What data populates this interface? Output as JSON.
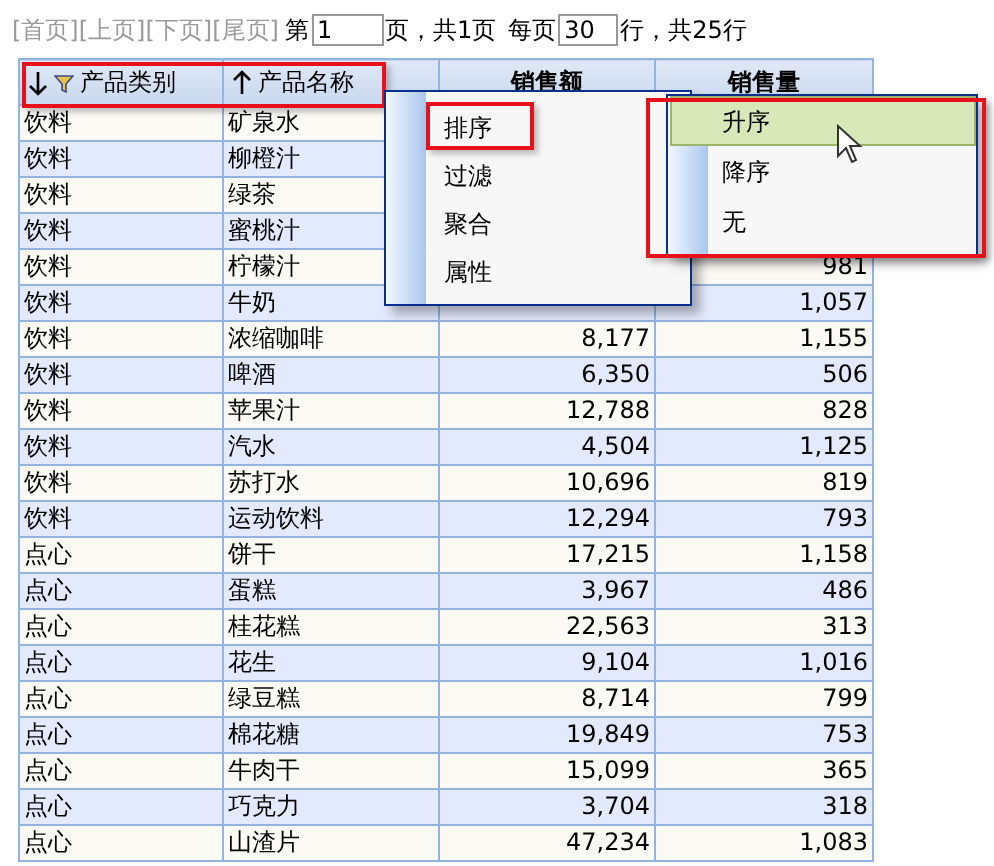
{
  "pager": {
    "links": [
      {
        "label": "[首页]",
        "disabled": true
      },
      {
        "label": "[上页]",
        "disabled": true
      },
      {
        "label": "[下页]",
        "disabled": true
      },
      {
        "label": "[尾页]",
        "disabled": true
      }
    ],
    "page_prefix": "第",
    "page_value": "1",
    "page_suffix": "页，共1页",
    "per_page_prefix": "每页",
    "per_page_value": "30",
    "per_page_suffix": "行，共25行"
  },
  "table": {
    "columns": [
      {
        "label": "产品类别",
        "kind": "text",
        "sorted_descending": true,
        "sorted_ascending": false,
        "filtered": true
      },
      {
        "label": "产品名称",
        "kind": "text",
        "sorted_descending": false,
        "sorted_ascending": true,
        "filtered": false
      },
      {
        "label": "销售额",
        "kind": "number",
        "sorted_descending": false,
        "sorted_ascending": false,
        "filtered": false
      },
      {
        "label": "销售量",
        "kind": "number",
        "sorted_descending": false,
        "sorted_ascending": false,
        "filtered": false
      }
    ],
    "rows": [
      {
        "category": "饮料",
        "name": "矿泉水"
      },
      {
        "category": "饮料",
        "name": "柳橙汁"
      },
      {
        "category": "饮料",
        "name": "绿茶"
      },
      {
        "category": "饮料",
        "name": "蜜桃汁"
      },
      {
        "category": "饮料",
        "name": "柠檬汁",
        "quantity": "981"
      },
      {
        "category": "饮料",
        "name": "牛奶",
        "quantity": "1,057"
      },
      {
        "category": "饮料",
        "name": "浓缩咖啡",
        "sales": "8,177",
        "quantity": "1,155"
      },
      {
        "category": "饮料",
        "name": "啤酒",
        "sales": "6,350",
        "quantity": "506"
      },
      {
        "category": "饮料",
        "name": "苹果汁",
        "sales": "12,788",
        "quantity": "828"
      },
      {
        "category": "饮料",
        "name": "汽水",
        "sales": "4,504",
        "quantity": "1,125"
      },
      {
        "category": "饮料",
        "name": "苏打水",
        "sales": "10,696",
        "quantity": "819"
      },
      {
        "category": "饮料",
        "name": "运动饮料",
        "sales": "12,294",
        "quantity": "793"
      },
      {
        "category": "点心",
        "name": "饼干",
        "sales": "17,215",
        "quantity": "1,158"
      },
      {
        "category": "点心",
        "name": "蛋糕",
        "sales": "3,967",
        "quantity": "486"
      },
      {
        "category": "点心",
        "name": "桂花糕",
        "sales": "22,563",
        "quantity": "313"
      },
      {
        "category": "点心",
        "name": "花生",
        "sales": "9,104",
        "quantity": "1,016"
      },
      {
        "category": "点心",
        "name": "绿豆糕",
        "sales": "8,714",
        "quantity": "799"
      },
      {
        "category": "点心",
        "name": "棉花糖",
        "sales": "19,849",
        "quantity": "753"
      },
      {
        "category": "点心",
        "name": "牛肉干",
        "sales": "15,099",
        "quantity": "365"
      },
      {
        "category": "点心",
        "name": "巧克力",
        "sales": "3,704",
        "quantity": "318"
      },
      {
        "category": "点心",
        "name": "山渣片",
        "sales": "47,234",
        "quantity": "1,083"
      }
    ]
  },
  "context_menu": {
    "items": [
      {
        "label": "排序",
        "selected": true
      },
      {
        "label": "过滤",
        "selected": false
      },
      {
        "label": "聚合",
        "selected": false
      },
      {
        "label": "属性",
        "selected": false
      }
    ]
  },
  "submenu": {
    "items": [
      {
        "label": "升序",
        "selected": true
      },
      {
        "label": "降序",
        "selected": false
      },
      {
        "label": "无",
        "selected": false
      }
    ]
  }
}
